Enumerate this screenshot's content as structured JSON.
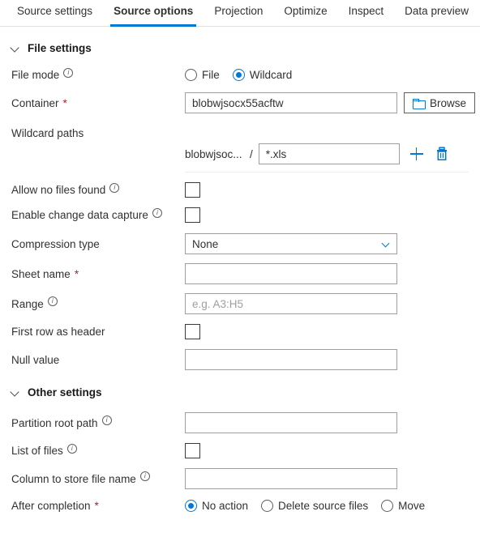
{
  "tabs": [
    {
      "label": "Source settings",
      "active": false
    },
    {
      "label": "Source options",
      "active": true
    },
    {
      "label": "Projection",
      "active": false
    },
    {
      "label": "Optimize",
      "active": false
    },
    {
      "label": "Inspect",
      "active": false
    },
    {
      "label": "Data preview",
      "active": false
    }
  ],
  "colors": {
    "accent": "#0078d4",
    "required_asterisk": "#a4262c",
    "text": "#323130",
    "border": "#a19f9d"
  },
  "file_settings": {
    "title": "File settings",
    "file_mode": {
      "label": "File mode",
      "options": [
        {
          "label": "File",
          "selected": false
        },
        {
          "label": "Wildcard",
          "selected": true
        }
      ]
    },
    "container": {
      "label": "Container",
      "required": "*",
      "value": "blobwjsocx55acftw",
      "browse_label": "Browse"
    },
    "wildcard_paths": {
      "label": "Wildcard paths",
      "prefix": "blobwjsoc...",
      "separator": "/",
      "value": "*.xls"
    },
    "allow_no_files_found": {
      "label": "Allow no files found",
      "checked": false
    },
    "enable_change_data_capture": {
      "label": "Enable change data capture",
      "checked": false
    },
    "compression_type": {
      "label": "Compression type",
      "value": "None"
    },
    "sheet_name": {
      "label": "Sheet name",
      "required": "*",
      "value": ""
    },
    "range": {
      "label": "Range",
      "value": "",
      "placeholder": "e.g. A3:H5"
    },
    "first_row_as_header": {
      "label": "First row as header",
      "checked": false
    },
    "null_value": {
      "label": "Null value",
      "value": ""
    }
  },
  "other_settings": {
    "title": "Other settings",
    "partition_root_path": {
      "label": "Partition root path",
      "value": ""
    },
    "list_of_files": {
      "label": "List of files",
      "checked": false
    },
    "column_to_store_file_name": {
      "label": "Column to store file name",
      "value": ""
    },
    "after_completion": {
      "label": "After completion",
      "required": "*",
      "options": [
        {
          "label": "No action",
          "selected": true
        },
        {
          "label": "Delete source files",
          "selected": false
        },
        {
          "label": "Move",
          "selected": false
        }
      ]
    }
  },
  "icons": {
    "info": "i",
    "chevron_down": "chevron-down",
    "folder": "folder",
    "plus": "plus",
    "trash": "trash"
  }
}
